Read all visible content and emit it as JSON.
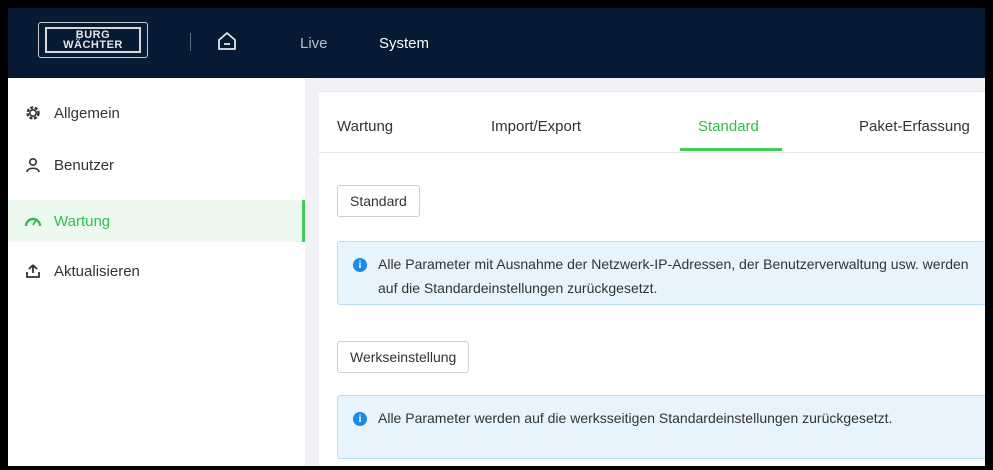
{
  "header": {
    "logo_line1": "BURG",
    "logo_line2": "WÄCHTER",
    "nav": {
      "live": "Live",
      "system": "System"
    }
  },
  "sidebar": {
    "items": [
      {
        "label": "Allgemein",
        "icon": "gear-icon"
      },
      {
        "label": "Benutzer",
        "icon": "user-icon"
      },
      {
        "label": "Wartung",
        "icon": "gauge-icon",
        "active": true
      },
      {
        "label": "Aktualisieren",
        "icon": "upload-icon"
      }
    ]
  },
  "tabs": [
    {
      "label": "Wartung"
    },
    {
      "label": "Import/Export"
    },
    {
      "label": "Standard",
      "active": true
    },
    {
      "label": "Paket-Erfassung"
    }
  ],
  "main": {
    "standard_button": "Standard",
    "standard_info": "Alle Parameter mit Ausnahme der Netzwerk-IP-Adressen, der Benutzerverwaltung usw. werden auf die Standardeinstellungen zurückgesetzt.",
    "factory_button": "Werkseinstellung",
    "factory_info": "Alle Parameter werden auf die werksseitigen Standardeinstellungen zurückgesetzt."
  },
  "colors": {
    "accent": "#3fcf56",
    "header_bg": "#071a33",
    "info_bg": "#e8f4fd",
    "info_icon": "#1d8be6"
  }
}
